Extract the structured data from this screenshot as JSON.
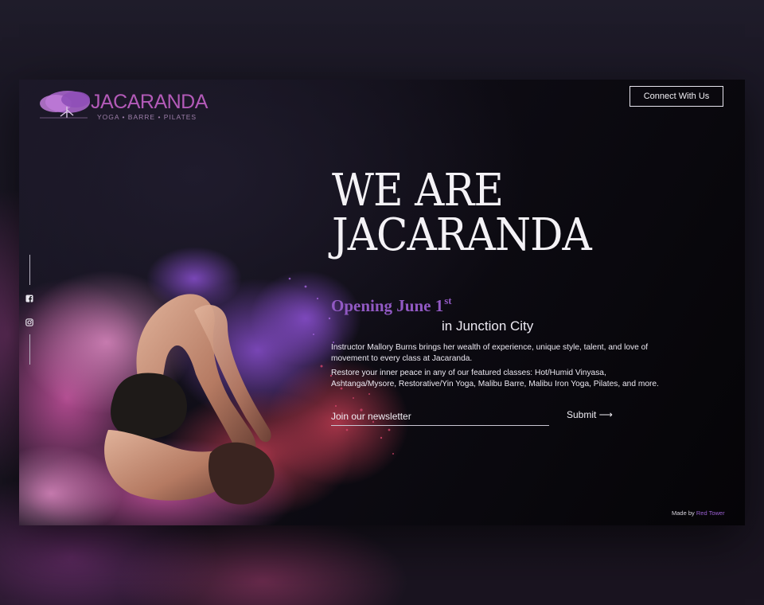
{
  "header": {
    "logo_name": "JACARANDA",
    "logo_tagline": "YOGA  •  BARRE  •  PILATES",
    "connect_label": "Connect With Us"
  },
  "social": {
    "icons": [
      "facebook-icon",
      "instagram-icon"
    ]
  },
  "hero": {
    "title_line1": "WE ARE",
    "title_line2": "JACARANDA",
    "opening_text": "Opening June 1",
    "opening_suffix": "st",
    "location": "in Junction City",
    "paragraph1": "Instructor Mallory Burns brings her wealth of experience, unique style, talent, and love of movement to every class at Jacaranda.",
    "paragraph2": "Restore your inner peace in any of our featured classes: Hot/Humid Vinyasa, Ashtanga/Mysore, Restorative/Yin Yoga, Malibu Barre, Malibu Iron Yoga, Pilates, and more."
  },
  "newsletter": {
    "placeholder": "Join our newsletter",
    "submit_label": "Submit ⟶"
  },
  "footer": {
    "credit_prefix": "Made by ",
    "credit_link": "Red Tower"
  },
  "colors": {
    "accent_purple": "#9159c3",
    "logo_purple": "#b35ab8",
    "background": "#0e0c14"
  }
}
